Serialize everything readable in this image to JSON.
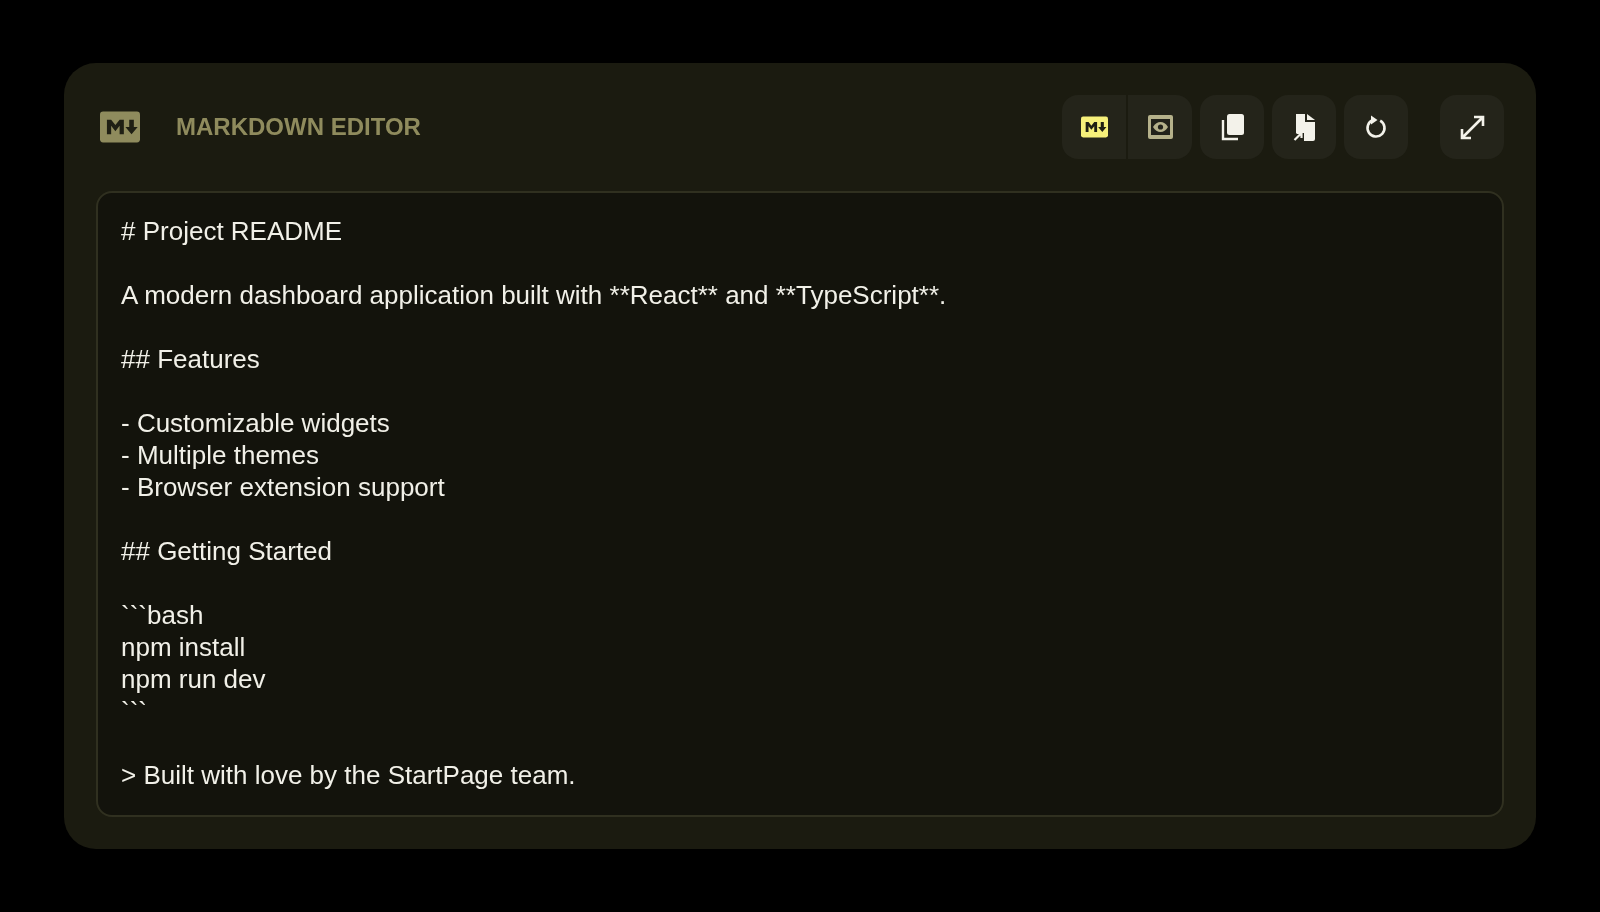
{
  "header": {
    "title": "MARKDOWN EDITOR"
  },
  "toolbar": {
    "view_modes": [
      {
        "kind": "markdown",
        "selected": true
      },
      {
        "kind": "preview",
        "selected": false
      }
    ]
  },
  "editor": {
    "value": "# Project README\n\nA modern dashboard application built with **React** and **TypeScript**.\n\n## Features\n\n- Customizable widgets\n- Multiple themes\n- Browser extension support\n\n## Getting Started\n\n```bash\nnpm install\nnpm run dev\n```\n\n> Built with love by the StartPage team."
  }
}
